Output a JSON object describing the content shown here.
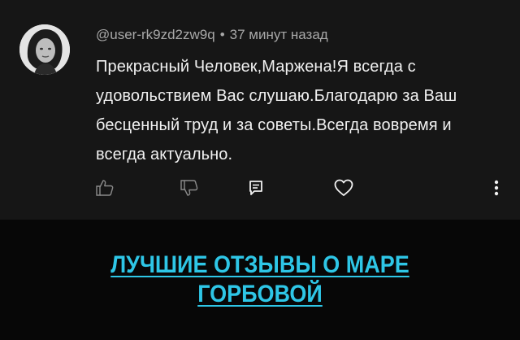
{
  "comment": {
    "username": "@user-rk9zd2zw9q",
    "separator": "•",
    "time": "37 минут назад",
    "text": "Прекрасный Человек,Маржена!Я всегда с удовольствием Вас слушаю.Благодарю за Ваш бесценный труд и за советы.Всегда вовремя и всегда актуально."
  },
  "actions": {
    "like_icon": "thumbs-up-icon",
    "dislike_icon": "thumbs-down-icon",
    "reply_icon": "reply-icon",
    "heart_icon": "heart-icon",
    "more_icon": "more-vertical-icon"
  },
  "promo": {
    "link_text": "ЛУЧШИЕ ОТЗЫВЫ О МАРЕ ГОРБОВОЙ",
    "link_color": "#2ec6e6"
  },
  "colors": {
    "card_background": "#161616",
    "page_background": "#070707",
    "text": "#f1f1f1",
    "meta": "#a8a8a8"
  }
}
